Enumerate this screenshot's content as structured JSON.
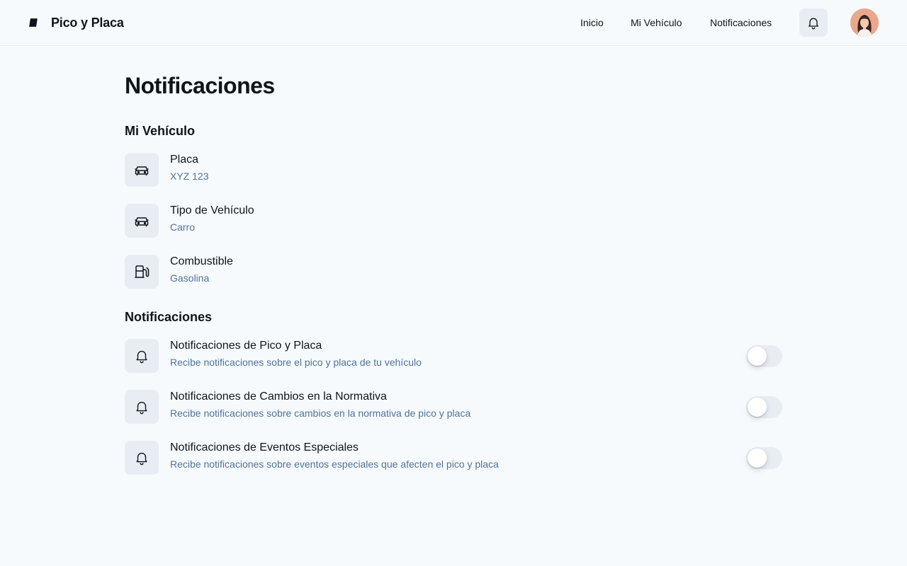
{
  "app": {
    "name": "Pico y Placa",
    "logo_icon": "logo-icon"
  },
  "nav": {
    "items": [
      {
        "label": "Inicio"
      },
      {
        "label": "Mi Vehículo"
      },
      {
        "label": "Notificaciones"
      }
    ],
    "bell_icon": "bell-icon",
    "avatar": "user-avatar"
  },
  "page": {
    "title": "Notificaciones"
  },
  "vehicle_section": {
    "title": "Mi Vehículo",
    "items": [
      {
        "icon": "car-icon",
        "label": "Placa",
        "value": "XYZ 123"
      },
      {
        "icon": "car-icon",
        "label": "Tipo de Vehículo",
        "value": "Carro"
      },
      {
        "icon": "fuel-icon",
        "label": "Combustible",
        "value": "Gasolina"
      }
    ]
  },
  "notifications_section": {
    "title": "Notificaciones",
    "items": [
      {
        "icon": "bell-icon",
        "label": "Notificaciones de Pico y Placa",
        "description": "Recibe notificaciones sobre el pico y placa de tu vehículo",
        "enabled": false
      },
      {
        "icon": "bell-icon",
        "label": "Notificaciones de Cambios en la Normativa",
        "description": "Recibe notificaciones sobre cambios en la normativa de pico y placa",
        "enabled": false
      },
      {
        "icon": "bell-icon",
        "label": "Notificaciones de Eventos Especiales",
        "description": "Recibe notificaciones sobre eventos especiales que afecten el pico y placa",
        "enabled": false
      }
    ]
  },
  "colors": {
    "background": "#f7fafc",
    "text": "#0e141b",
    "muted": "#4e7397",
    "icon_bg": "#e7edf3"
  }
}
